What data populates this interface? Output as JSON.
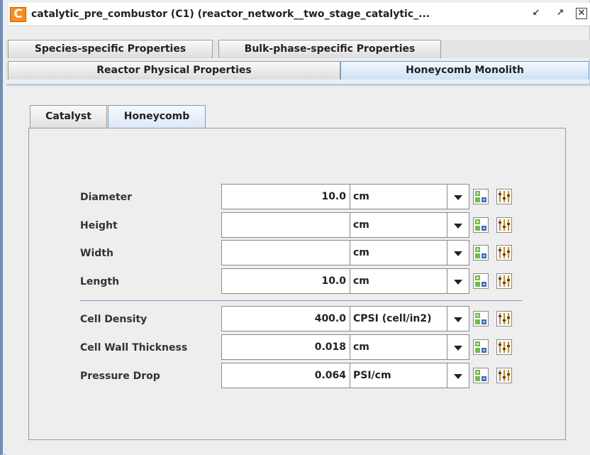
{
  "window": {
    "title": "catalytic_pre_combustor (C1)  (reactor_network__two_stage_catalytic_...",
    "icon_letter": "C",
    "accent": "#ff8c1a"
  },
  "outer_tabs_row1": [
    "Species-specific Properties",
    "Bulk-phase-specific Properties"
  ],
  "outer_tabs_row2": [
    "Reactor Physical Properties",
    "Honeycomb Monolith"
  ],
  "outer_tab_selected": "Honeycomb Monolith",
  "inner_tabs": [
    "Catalyst",
    "Honeycomb"
  ],
  "inner_tab_selected": "Honeycomb",
  "rows": [
    {
      "label": "Diameter",
      "value": "10.0",
      "unit": "cm"
    },
    {
      "label": "Height",
      "value": "",
      "unit": "cm"
    },
    {
      "label": "Width",
      "value": "",
      "unit": "cm"
    },
    {
      "label": "Length",
      "value": "10.0",
      "unit": "cm"
    },
    {
      "label": "Cell Density",
      "value": "400.0",
      "unit": "CPSI (cell/in2)"
    },
    {
      "label": "Cell Wall Thickness",
      "value": "0.018",
      "unit": "cm"
    },
    {
      "label": "Pressure Drop",
      "value": "0.064",
      "unit": "PSI/cm"
    }
  ],
  "icons": {
    "row_button_1": "expand-collapse-icon",
    "row_button_2": "parameter-sliders-icon",
    "window_buttons": [
      "minimize-icon",
      "maximize-icon",
      "close-icon"
    ]
  }
}
